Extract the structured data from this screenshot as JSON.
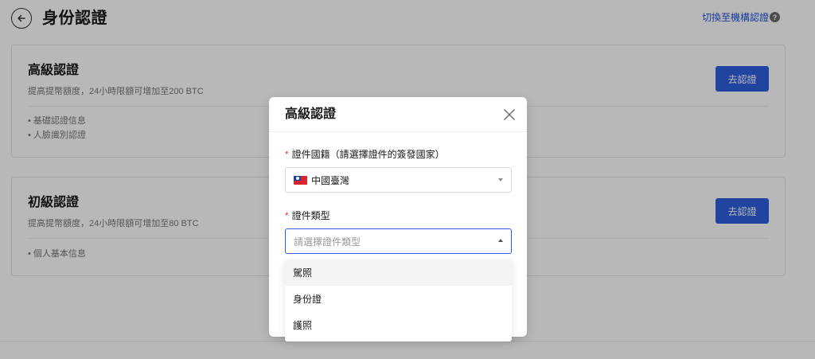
{
  "header": {
    "title": "身份認證",
    "switch_link": "切換至機構認證",
    "help_icon": "?"
  },
  "cards": {
    "advanced": {
      "title": "高級認證",
      "desc": "提高提幣額度，24小時限額可增加至200 BTC",
      "items": [
        "• 基礎認證信息",
        "• 人臉識別認證"
      ],
      "button": "去認證"
    },
    "basic": {
      "title": "初級認證",
      "desc": "提高提幣額度，24小時限額可增加至80 BTC",
      "items": [
        "• 個人基本信息"
      ],
      "button": "去認證"
    }
  },
  "modal": {
    "title": "高級認證",
    "nationality": {
      "required_mark": "*",
      "label": "證件國籍（請選擇證件的簽發國家）",
      "value": "中國臺灣",
      "flag_icon": "taiwan-flag-icon"
    },
    "doc_type": {
      "required_mark": "*",
      "label": "證件類型",
      "placeholder": "請選擇證件類型",
      "options": [
        "駕照",
        "身份證",
        "護照"
      ]
    }
  },
  "colors": {
    "accent": "#2f5fe0",
    "link": "#1f4fd6",
    "required": "#e23b3b",
    "overlay": "rgba(0,0,0,0.28)"
  }
}
